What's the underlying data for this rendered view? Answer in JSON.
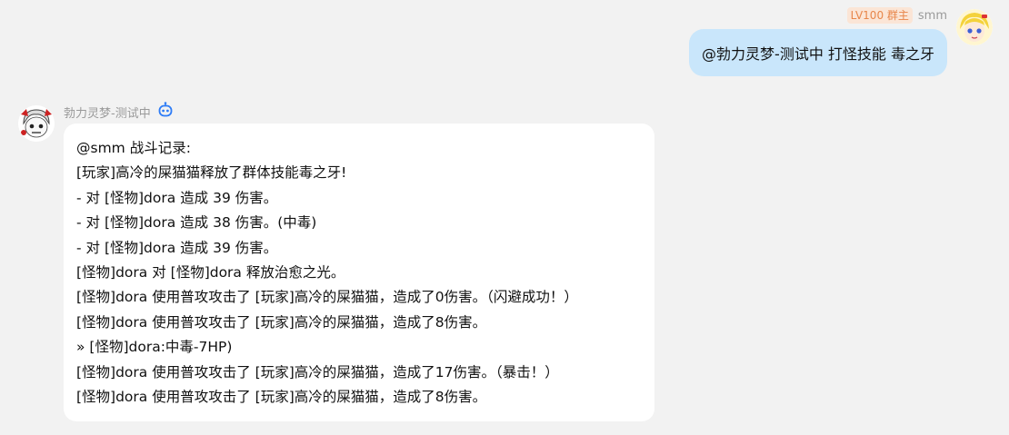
{
  "outgoing": {
    "badge": "LV100 群主",
    "sender": "smm",
    "text": "@勃力灵梦-测试中 打怪技能 毒之牙"
  },
  "incoming": {
    "sender": "勃力灵梦-测试中",
    "lines": [
      "@smm 战斗记录:",
      "[玩家]高冷的屎猫猫释放了群体技能毒之牙!",
      "- 对 [怪物]dora 造成 39 伤害。",
      "- 对 [怪物]dora 造成 38 伤害。(中毒)",
      "- 对 [怪物]dora 造成 39 伤害。",
      "[怪物]dora 对 [怪物]dora 释放治愈之光。",
      "[怪物]dora 使用普攻攻击了 [玩家]高冷的屎猫猫，造成了0伤害。（闪避成功！）",
      "[怪物]dora 使用普攻攻击了 [玩家]高冷的屎猫猫，造成了8伤害。",
      "» [怪物]dora:中毒-7HP)",
      "[怪物]dora 使用普攻攻击了 [玩家]高冷的屎猫猫，造成了17伤害。（暴击！）",
      "[怪物]dora 使用普攻攻击了 [玩家]高冷的屎猫猫，造成了8伤害。"
    ]
  },
  "colors": {
    "background": "#f2f2f2",
    "outgoing_bubble": "#c9e6fb",
    "incoming_bubble": "#ffffff",
    "badge_bg": "#fbe5d6",
    "badge_text": "#e8864a",
    "bot_icon": "#2e7cf6"
  },
  "icons": {
    "bot": "robot-icon",
    "avatar_user": "yellow-hair-avatar",
    "avatar_bot": "anime-avatar"
  }
}
